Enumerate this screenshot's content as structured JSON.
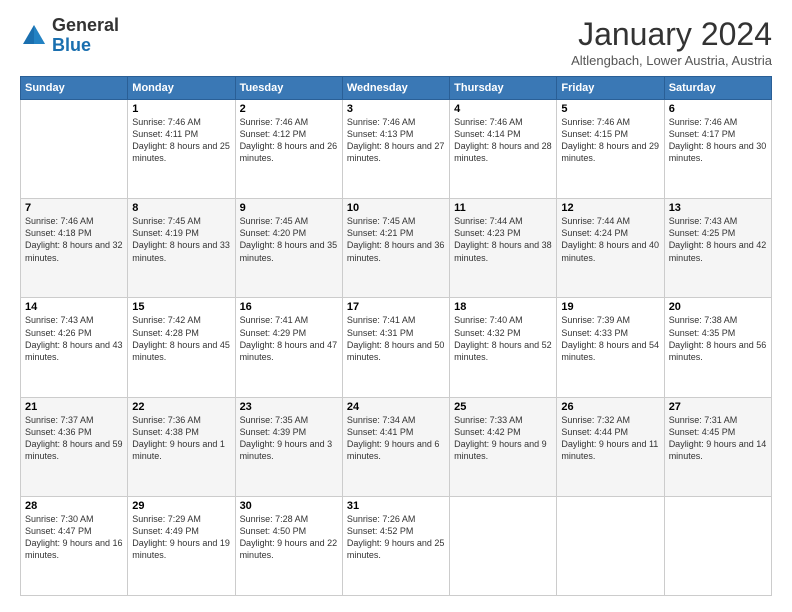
{
  "logo": {
    "general": "General",
    "blue": "Blue"
  },
  "header": {
    "title": "January 2024",
    "subtitle": "Altlengbach, Lower Austria, Austria"
  },
  "days_of_week": [
    "Sunday",
    "Monday",
    "Tuesday",
    "Wednesday",
    "Thursday",
    "Friday",
    "Saturday"
  ],
  "weeks": [
    [
      {
        "day": "",
        "sunrise": "",
        "sunset": "",
        "daylight": ""
      },
      {
        "day": "1",
        "sunrise": "Sunrise: 7:46 AM",
        "sunset": "Sunset: 4:11 PM",
        "daylight": "Daylight: 8 hours and 25 minutes."
      },
      {
        "day": "2",
        "sunrise": "Sunrise: 7:46 AM",
        "sunset": "Sunset: 4:12 PM",
        "daylight": "Daylight: 8 hours and 26 minutes."
      },
      {
        "day": "3",
        "sunrise": "Sunrise: 7:46 AM",
        "sunset": "Sunset: 4:13 PM",
        "daylight": "Daylight: 8 hours and 27 minutes."
      },
      {
        "day": "4",
        "sunrise": "Sunrise: 7:46 AM",
        "sunset": "Sunset: 4:14 PM",
        "daylight": "Daylight: 8 hours and 28 minutes."
      },
      {
        "day": "5",
        "sunrise": "Sunrise: 7:46 AM",
        "sunset": "Sunset: 4:15 PM",
        "daylight": "Daylight: 8 hours and 29 minutes."
      },
      {
        "day": "6",
        "sunrise": "Sunrise: 7:46 AM",
        "sunset": "Sunset: 4:17 PM",
        "daylight": "Daylight: 8 hours and 30 minutes."
      }
    ],
    [
      {
        "day": "7",
        "sunrise": "Sunrise: 7:46 AM",
        "sunset": "Sunset: 4:18 PM",
        "daylight": "Daylight: 8 hours and 32 minutes."
      },
      {
        "day": "8",
        "sunrise": "Sunrise: 7:45 AM",
        "sunset": "Sunset: 4:19 PM",
        "daylight": "Daylight: 8 hours and 33 minutes."
      },
      {
        "day": "9",
        "sunrise": "Sunrise: 7:45 AM",
        "sunset": "Sunset: 4:20 PM",
        "daylight": "Daylight: 8 hours and 35 minutes."
      },
      {
        "day": "10",
        "sunrise": "Sunrise: 7:45 AM",
        "sunset": "Sunset: 4:21 PM",
        "daylight": "Daylight: 8 hours and 36 minutes."
      },
      {
        "day": "11",
        "sunrise": "Sunrise: 7:44 AM",
        "sunset": "Sunset: 4:23 PM",
        "daylight": "Daylight: 8 hours and 38 minutes."
      },
      {
        "day": "12",
        "sunrise": "Sunrise: 7:44 AM",
        "sunset": "Sunset: 4:24 PM",
        "daylight": "Daylight: 8 hours and 40 minutes."
      },
      {
        "day": "13",
        "sunrise": "Sunrise: 7:43 AM",
        "sunset": "Sunset: 4:25 PM",
        "daylight": "Daylight: 8 hours and 42 minutes."
      }
    ],
    [
      {
        "day": "14",
        "sunrise": "Sunrise: 7:43 AM",
        "sunset": "Sunset: 4:26 PM",
        "daylight": "Daylight: 8 hours and 43 minutes."
      },
      {
        "day": "15",
        "sunrise": "Sunrise: 7:42 AM",
        "sunset": "Sunset: 4:28 PM",
        "daylight": "Daylight: 8 hours and 45 minutes."
      },
      {
        "day": "16",
        "sunrise": "Sunrise: 7:41 AM",
        "sunset": "Sunset: 4:29 PM",
        "daylight": "Daylight: 8 hours and 47 minutes."
      },
      {
        "day": "17",
        "sunrise": "Sunrise: 7:41 AM",
        "sunset": "Sunset: 4:31 PM",
        "daylight": "Daylight: 8 hours and 50 minutes."
      },
      {
        "day": "18",
        "sunrise": "Sunrise: 7:40 AM",
        "sunset": "Sunset: 4:32 PM",
        "daylight": "Daylight: 8 hours and 52 minutes."
      },
      {
        "day": "19",
        "sunrise": "Sunrise: 7:39 AM",
        "sunset": "Sunset: 4:33 PM",
        "daylight": "Daylight: 8 hours and 54 minutes."
      },
      {
        "day": "20",
        "sunrise": "Sunrise: 7:38 AM",
        "sunset": "Sunset: 4:35 PM",
        "daylight": "Daylight: 8 hours and 56 minutes."
      }
    ],
    [
      {
        "day": "21",
        "sunrise": "Sunrise: 7:37 AM",
        "sunset": "Sunset: 4:36 PM",
        "daylight": "Daylight: 8 hours and 59 minutes."
      },
      {
        "day": "22",
        "sunrise": "Sunrise: 7:36 AM",
        "sunset": "Sunset: 4:38 PM",
        "daylight": "Daylight: 9 hours and 1 minute."
      },
      {
        "day": "23",
        "sunrise": "Sunrise: 7:35 AM",
        "sunset": "Sunset: 4:39 PM",
        "daylight": "Daylight: 9 hours and 3 minutes."
      },
      {
        "day": "24",
        "sunrise": "Sunrise: 7:34 AM",
        "sunset": "Sunset: 4:41 PM",
        "daylight": "Daylight: 9 hours and 6 minutes."
      },
      {
        "day": "25",
        "sunrise": "Sunrise: 7:33 AM",
        "sunset": "Sunset: 4:42 PM",
        "daylight": "Daylight: 9 hours and 9 minutes."
      },
      {
        "day": "26",
        "sunrise": "Sunrise: 7:32 AM",
        "sunset": "Sunset: 4:44 PM",
        "daylight": "Daylight: 9 hours and 11 minutes."
      },
      {
        "day": "27",
        "sunrise": "Sunrise: 7:31 AM",
        "sunset": "Sunset: 4:45 PM",
        "daylight": "Daylight: 9 hours and 14 minutes."
      }
    ],
    [
      {
        "day": "28",
        "sunrise": "Sunrise: 7:30 AM",
        "sunset": "Sunset: 4:47 PM",
        "daylight": "Daylight: 9 hours and 16 minutes."
      },
      {
        "day": "29",
        "sunrise": "Sunrise: 7:29 AM",
        "sunset": "Sunset: 4:49 PM",
        "daylight": "Daylight: 9 hours and 19 minutes."
      },
      {
        "day": "30",
        "sunrise": "Sunrise: 7:28 AM",
        "sunset": "Sunset: 4:50 PM",
        "daylight": "Daylight: 9 hours and 22 minutes."
      },
      {
        "day": "31",
        "sunrise": "Sunrise: 7:26 AM",
        "sunset": "Sunset: 4:52 PM",
        "daylight": "Daylight: 9 hours and 25 minutes."
      },
      {
        "day": "",
        "sunrise": "",
        "sunset": "",
        "daylight": ""
      },
      {
        "day": "",
        "sunrise": "",
        "sunset": "",
        "daylight": ""
      },
      {
        "day": "",
        "sunrise": "",
        "sunset": "",
        "daylight": ""
      }
    ]
  ]
}
